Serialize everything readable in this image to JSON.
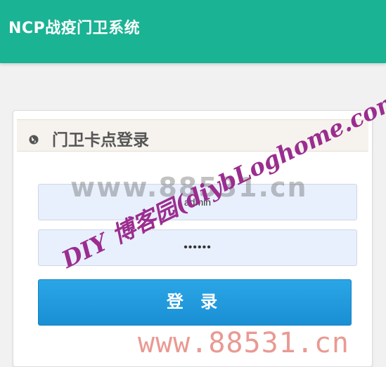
{
  "header": {
    "app_title": "NCP战疫门卫系统"
  },
  "login_panel": {
    "title": "门卫卡点登录",
    "username": {
      "value": "admin"
    },
    "password": {
      "value": "••••••"
    },
    "submit_label": "登 录",
    "icon": "globe-icon"
  },
  "watermarks": {
    "site_large": "www.88531.cn",
    "site_diagonal": "DIY 博客园(diybLoghome.com)",
    "site_bottom": "www.88531.cn"
  },
  "colors": {
    "header_bg": "#1ab394",
    "button_bg": "#1a8fd4",
    "input_bg": "#e8f0fe",
    "page_bg": "#f1f1f1",
    "watermark_purple": "#9b2d8f"
  }
}
